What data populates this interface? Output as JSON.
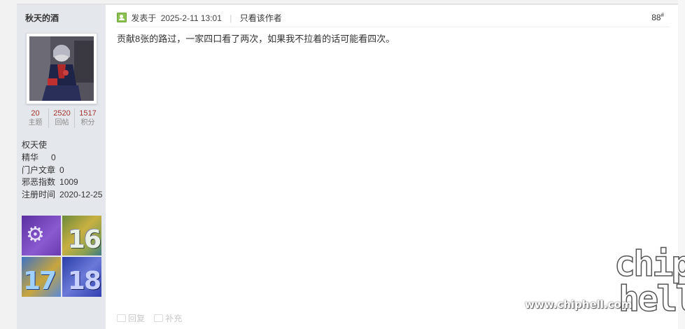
{
  "author": {
    "name": "秋天的酒",
    "stats": [
      {
        "value": "20",
        "label": "主题"
      },
      {
        "value": "2520",
        "label": "回帖"
      },
      {
        "value": "1517",
        "label": "积分"
      }
    ],
    "title": "权天使",
    "info": [
      {
        "key": "精华",
        "value": "0"
      },
      {
        "key": "门户文章",
        "value": "0"
      },
      {
        "key": "邪恶指数",
        "value": "1009"
      },
      {
        "key": "注册时间",
        "value": "2020-12-25"
      }
    ],
    "medals": [
      {
        "icon": "medal-icon",
        "label": ""
      },
      {
        "icon": "medal-16-icon",
        "label": "16"
      },
      {
        "icon": "medal-17-icon",
        "label": "17"
      },
      {
        "icon": "medal-18-icon",
        "label": "18"
      }
    ]
  },
  "post": {
    "posted_prefix": "发表于",
    "posted_time": "2025-2-11 13:01",
    "author_only_link": "只看该作者",
    "floor_number": "88",
    "floor_mark": "#",
    "content": "贡献8张的路过，一家四口看了两次，如果我不拉着的话可能看四次。",
    "actions": {
      "reply": "回复",
      "supplement": "补充"
    }
  },
  "watermark": {
    "url": "www.chiphell.com",
    "logo_line1": "chip",
    "logo_line2": "hell"
  },
  "colors": {
    "sidebar_bg": "#e4e7ec",
    "stat_number": "#a5342f",
    "online_icon": "#8cc152"
  }
}
